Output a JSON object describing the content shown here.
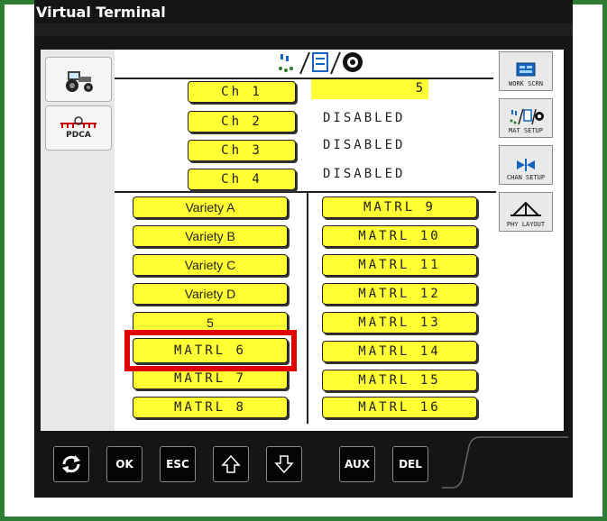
{
  "window": {
    "title": "Virtual Terminal"
  },
  "left_softkeys": [
    {
      "icon": "tractor-icon",
      "label": ""
    },
    {
      "icon": "sprayer-icon",
      "label": "PDCA"
    }
  ],
  "right_softkeys": [
    {
      "icon": "work-screen-icon",
      "label": "WORK SCRN"
    },
    {
      "icon": "material-setup-icon",
      "label": "MAT SETUP"
    },
    {
      "icon": "channel-setup-icon",
      "label": "CHAN SETUP"
    },
    {
      "icon": "physical-layout-icon",
      "label": "PHY LAYOUT"
    }
  ],
  "header": {
    "icon": "material-setup-header-icon"
  },
  "channels": [
    {
      "label": "Ch 1",
      "status": "5"
    },
    {
      "label": "Ch 2",
      "status": "DISABLED"
    },
    {
      "label": "Ch 3",
      "status": "DISABLED"
    },
    {
      "label": "Ch 4",
      "status": "DISABLED"
    }
  ],
  "materials_left": [
    "Variety A",
    "Variety B",
    "Variety C",
    "Variety D",
    "5",
    "MATRL 6",
    "MATRL 7",
    "MATRL 8"
  ],
  "materials_right": [
    "MATRL 9",
    "MATRL 10",
    "MATRL 11",
    "MATRL 12",
    "MATRL 13",
    "MATRL 14",
    "MATRL 15",
    "MATRL 16"
  ],
  "highlighted_item": "MATRL 6",
  "bottom_keys": [
    {
      "name": "refresh",
      "label": "",
      "icon": "refresh-icon"
    },
    {
      "name": "ok",
      "label": "OK"
    },
    {
      "name": "esc",
      "label": "ESC"
    },
    {
      "name": "up",
      "label": "",
      "icon": "arrow-up-icon"
    },
    {
      "name": "down",
      "label": "",
      "icon": "arrow-down-icon"
    },
    {
      "name": "aux",
      "label": "AUX"
    },
    {
      "name": "del",
      "label": "DEL"
    }
  ],
  "colors": {
    "frame": "#2e7d32",
    "button_fill": "#ffff33",
    "highlight": "#e00000"
  }
}
